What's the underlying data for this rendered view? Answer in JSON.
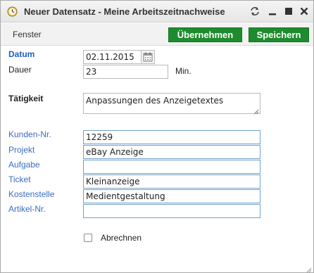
{
  "window": {
    "title": "Neuer Datensatz - Meine Arbeitszeitnachweise",
    "icon": "clock-icon"
  },
  "toolbar": {
    "menu_label": "Fenster",
    "apply_label": "Übernehmen",
    "save_label": "Speichern",
    "button_color": "#1e8b2f"
  },
  "form": {
    "datum": {
      "label": "Datum",
      "value": "02.11.2015"
    },
    "dauer": {
      "label": "Dauer",
      "value": "23",
      "unit": "Min."
    },
    "taetigkeit": {
      "label": "Tätigkeit",
      "value": "Anpassungen des Anzeigetextes"
    },
    "kunden_nr": {
      "label": "Kunden-Nr.",
      "value": "12259"
    },
    "projekt": {
      "label": "Projekt",
      "value": "eBay Anzeige"
    },
    "aufgabe": {
      "label": "Aufgabe",
      "value": ""
    },
    "ticket": {
      "label": "Ticket",
      "value": "Kleinanzeige"
    },
    "kostenstelle": {
      "label": "Kostenstelle",
      "value": "Medientgestaltung"
    },
    "artikel_nr": {
      "label": "Artikel-Nr.",
      "value": ""
    },
    "abrechnen": {
      "label": "Abrechnen",
      "checked": false
    }
  },
  "colors": {
    "required_label": "#1f5fbf",
    "link_label": "#3a6cc2",
    "field_border_blue": "#6fa0c8"
  }
}
